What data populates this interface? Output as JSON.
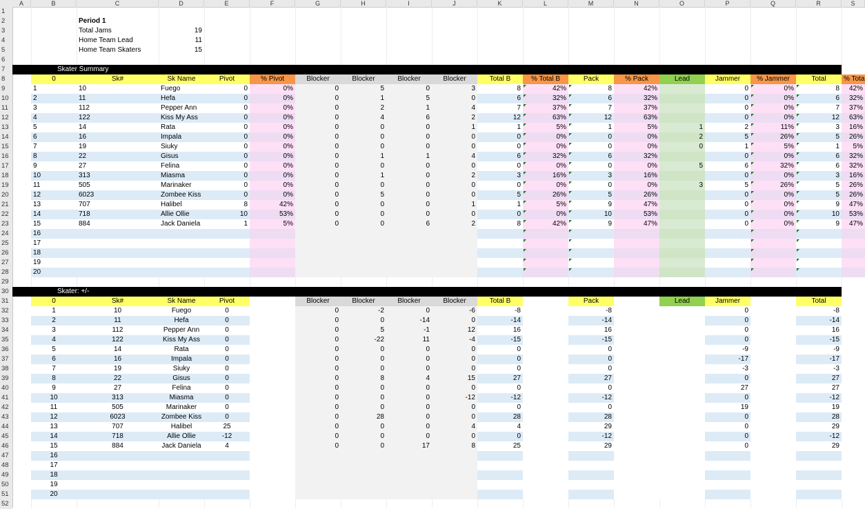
{
  "columns": [
    "A",
    "B",
    "C",
    "D",
    "E",
    "F",
    "G",
    "H",
    "I",
    "J",
    "K",
    "L",
    "M",
    "N",
    "O",
    "P",
    "Q",
    "R",
    "S"
  ],
  "info": {
    "title": "Period 1",
    "rows": [
      {
        "label": "Total Jams",
        "value": "19"
      },
      {
        "label": "Home Team Lead",
        "value": "11"
      },
      {
        "label": "Home Team Skaters",
        "value": "15"
      }
    ]
  },
  "summary": {
    "banner": "Skater Summary",
    "headers": [
      "0",
      "Sk#",
      "Sk Name",
      "Pivot",
      "% Pivot",
      "Blocker",
      "Blocker",
      "Blocker",
      "Blocker",
      "Total B",
      "% Total B",
      "Pack",
      "% Pack",
      "Lead",
      "Jammer",
      "% Jammer",
      "Total",
      "% Total"
    ],
    "rows": [
      [
        "1",
        "10",
        "Fuego",
        "0",
        "0%",
        "0",
        "5",
        "0",
        "3",
        "8",
        "42%",
        "8",
        "42%",
        "",
        "0",
        "0%",
        "8",
        "42%"
      ],
      [
        "2",
        "11",
        "Hefa",
        "0",
        "0%",
        "0",
        "1",
        "5",
        "0",
        "6",
        "32%",
        "6",
        "32%",
        "",
        "0",
        "0%",
        "6",
        "32%"
      ],
      [
        "3",
        "112",
        "Pepper Ann",
        "0",
        "0%",
        "0",
        "2",
        "1",
        "4",
        "7",
        "37%",
        "7",
        "37%",
        "",
        "0",
        "0%",
        "7",
        "37%"
      ],
      [
        "4",
        "122",
        "Kiss My Ass",
        "0",
        "0%",
        "0",
        "4",
        "6",
        "2",
        "12",
        "63%",
        "12",
        "63%",
        "",
        "0",
        "0%",
        "12",
        "63%"
      ],
      [
        "5",
        "14",
        "Rata",
        "0",
        "0%",
        "0",
        "0",
        "0",
        "1",
        "1",
        "5%",
        "1",
        "5%",
        "1",
        "2",
        "11%",
        "3",
        "16%"
      ],
      [
        "6",
        "16",
        "Impala",
        "0",
        "0%",
        "0",
        "0",
        "0",
        "0",
        "0",
        "0%",
        "0",
        "0%",
        "2",
        "5",
        "26%",
        "5",
        "26%"
      ],
      [
        "7",
        "19",
        "Siuky",
        "0",
        "0%",
        "0",
        "0",
        "0",
        "0",
        "0",
        "0%",
        "0",
        "0%",
        "0",
        "1",
        "5%",
        "1",
        "5%"
      ],
      [
        "8",
        "22",
        "Gisus",
        "0",
        "0%",
        "0",
        "1",
        "1",
        "4",
        "6",
        "32%",
        "6",
        "32%",
        "",
        "0",
        "0%",
        "6",
        "32%"
      ],
      [
        "9",
        "27",
        "Felina",
        "0",
        "0%",
        "0",
        "0",
        "0",
        "0",
        "0",
        "0%",
        "0",
        "0%",
        "5",
        "6",
        "32%",
        "6",
        "32%"
      ],
      [
        "10",
        "313",
        "Miasma",
        "0",
        "0%",
        "0",
        "1",
        "0",
        "2",
        "3",
        "16%",
        "3",
        "16%",
        "",
        "0",
        "0%",
        "3",
        "16%"
      ],
      [
        "11",
        "505",
        "Marinaker",
        "0",
        "0%",
        "0",
        "0",
        "0",
        "0",
        "0",
        "0%",
        "0",
        "0%",
        "3",
        "5",
        "26%",
        "5",
        "26%"
      ],
      [
        "12",
        "6023",
        "Zombee Kiss",
        "0",
        "0%",
        "0",
        "5",
        "0",
        "0",
        "5",
        "26%",
        "5",
        "26%",
        "",
        "0",
        "0%",
        "5",
        "26%"
      ],
      [
        "13",
        "707",
        "Halibel",
        "8",
        "42%",
        "0",
        "0",
        "0",
        "1",
        "1",
        "5%",
        "9",
        "47%",
        "",
        "0",
        "0%",
        "9",
        "47%"
      ],
      [
        "14",
        "718",
        "Allie Ollie",
        "10",
        "53%",
        "0",
        "0",
        "0",
        "0",
        "0",
        "0%",
        "10",
        "53%",
        "",
        "0",
        "0%",
        "10",
        "53%"
      ],
      [
        "15",
        "884",
        "Jack Daniela",
        "1",
        "5%",
        "0",
        "0",
        "6",
        "2",
        "8",
        "42%",
        "9",
        "47%",
        "",
        "0",
        "0%",
        "9",
        "47%"
      ],
      [
        "16",
        "",
        "",
        "",
        "",
        "",
        "",
        "",
        "",
        "",
        "",
        "",
        "",
        "",
        "",
        "",
        "",
        ""
      ],
      [
        "17",
        "",
        "",
        "",
        "",
        "",
        "",
        "",
        "",
        "",
        "",
        "",
        "",
        "",
        "",
        "",
        "",
        ""
      ],
      [
        "18",
        "",
        "",
        "",
        "",
        "",
        "",
        "",
        "",
        "",
        "",
        "",
        "",
        "",
        "",
        "",
        "",
        ""
      ],
      [
        "19",
        "",
        "",
        "",
        "",
        "",
        "",
        "",
        "",
        "",
        "",
        "",
        "",
        "",
        "",
        "",
        "",
        ""
      ],
      [
        "20",
        "",
        "",
        "",
        "",
        "",
        "",
        "",
        "",
        "",
        "",
        "",
        "",
        "",
        "",
        "",
        "",
        ""
      ]
    ]
  },
  "plusminus": {
    "banner": "Skater: +/-",
    "headers": [
      "0",
      "Sk#",
      "Sk Name",
      "Pivot",
      "",
      "Blocker",
      "Blocker",
      "Blocker",
      "Blocker",
      "Total B",
      "",
      "Pack",
      "",
      "Lead",
      "Jammer",
      "",
      "Total",
      ""
    ],
    "rows": [
      [
        "1",
        "10",
        "Fuego",
        "0",
        "",
        "0",
        "-2",
        "0",
        "-6",
        "-8",
        "",
        "-8",
        "",
        "",
        "0",
        "",
        "-8",
        ""
      ],
      [
        "2",
        "11",
        "Hefa",
        "0",
        "",
        "0",
        "0",
        "-14",
        "0",
        "-14",
        "",
        "-14",
        "",
        "",
        "0",
        "",
        "-14",
        ""
      ],
      [
        "3",
        "112",
        "Pepper Ann",
        "0",
        "",
        "0",
        "5",
        "-1",
        "12",
        "16",
        "",
        "16",
        "",
        "",
        "0",
        "",
        "16",
        ""
      ],
      [
        "4",
        "122",
        "Kiss My Ass",
        "0",
        "",
        "0",
        "-22",
        "11",
        "-4",
        "-15",
        "",
        "-15",
        "",
        "",
        "0",
        "",
        "-15",
        ""
      ],
      [
        "5",
        "14",
        "Rata",
        "0",
        "",
        "0",
        "0",
        "0",
        "0",
        "0",
        "",
        "0",
        "",
        "",
        "-9",
        "",
        "-9",
        ""
      ],
      [
        "6",
        "16",
        "Impala",
        "0",
        "",
        "0",
        "0",
        "0",
        "0",
        "0",
        "",
        "0",
        "",
        "",
        "-17",
        "",
        "-17",
        ""
      ],
      [
        "7",
        "19",
        "Siuky",
        "0",
        "",
        "0",
        "0",
        "0",
        "0",
        "0",
        "",
        "0",
        "",
        "",
        "-3",
        "",
        "-3",
        ""
      ],
      [
        "8",
        "22",
        "Gisus",
        "0",
        "",
        "0",
        "8",
        "4",
        "15",
        "27",
        "",
        "27",
        "",
        "",
        "0",
        "",
        "27",
        ""
      ],
      [
        "9",
        "27",
        "Felina",
        "0",
        "",
        "0",
        "0",
        "0",
        "0",
        "0",
        "",
        "0",
        "",
        "",
        "27",
        "",
        "27",
        ""
      ],
      [
        "10",
        "313",
        "Miasma",
        "0",
        "",
        "0",
        "0",
        "0",
        "-12",
        "-12",
        "",
        "-12",
        "",
        "",
        "0",
        "",
        "-12",
        ""
      ],
      [
        "11",
        "505",
        "Marinaker",
        "0",
        "",
        "0",
        "0",
        "0",
        "0",
        "0",
        "",
        "0",
        "",
        "",
        "19",
        "",
        "19",
        ""
      ],
      [
        "12",
        "6023",
        "Zombee Kiss",
        "0",
        "",
        "0",
        "28",
        "0",
        "0",
        "28",
        "",
        "28",
        "",
        "",
        "0",
        "",
        "28",
        ""
      ],
      [
        "13",
        "707",
        "Halibel",
        "25",
        "",
        "0",
        "0",
        "0",
        "4",
        "4",
        "",
        "29",
        "",
        "",
        "0",
        "",
        "29",
        ""
      ],
      [
        "14",
        "718",
        "Allie Ollie",
        "-12",
        "",
        "0",
        "0",
        "0",
        "0",
        "0",
        "",
        "-12",
        "",
        "",
        "0",
        "",
        "-12",
        ""
      ],
      [
        "15",
        "884",
        "Jack Daniela",
        "4",
        "",
        "0",
        "0",
        "17",
        "8",
        "25",
        "",
        "29",
        "",
        "",
        "0",
        "",
        "29",
        ""
      ],
      [
        "16",
        "",
        "",
        "",
        "",
        "",
        "",
        "",
        "",
        "",
        "",
        "",
        "",
        "",
        "",
        "",
        "",
        ""
      ],
      [
        "17",
        "",
        "",
        "",
        "",
        "",
        "",
        "",
        "",
        "",
        "",
        "",
        "",
        "",
        "",
        "",
        "",
        ""
      ],
      [
        "18",
        "",
        "",
        "",
        "",
        "",
        "",
        "",
        "",
        "",
        "",
        "",
        "",
        "",
        "",
        "",
        "",
        ""
      ],
      [
        "19",
        "",
        "",
        "",
        "",
        "",
        "",
        "",
        "",
        "",
        "",
        "",
        "",
        "",
        "",
        "",
        "",
        ""
      ],
      [
        "20",
        "",
        "",
        "",
        "",
        "",
        "",
        "",
        "",
        "",
        "",
        "",
        "",
        "",
        "",
        "",
        "",
        ""
      ]
    ]
  },
  "colors": {
    "yellow_header": "#ffff66",
    "orange_header": "#f79646",
    "green_header": "#92d050",
    "grey_header": "#d9d9d9",
    "light_blue": "#ddebf7",
    "light_pink": "#fce4f5",
    "light_green": "#d9ead3",
    "light_grey": "#f2f2f2",
    "banner": "#000000"
  }
}
